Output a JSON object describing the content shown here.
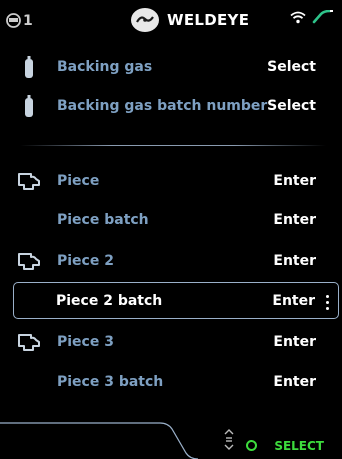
{
  "status": {
    "left_label": "1",
    "brand": "WELDEYE"
  },
  "rows": [
    {
      "label": "Backing gas",
      "action": "Select",
      "icon": "gas-bottle-icon"
    },
    {
      "label": "Backing gas batch number",
      "action": "Select",
      "icon": "gas-bottle-icon"
    },
    {
      "label": "Piece",
      "action": "Enter",
      "icon": "piece-icon"
    },
    {
      "label": "Piece batch",
      "action": "Enter",
      "icon": ""
    },
    {
      "label": "Piece 2",
      "action": "Enter",
      "icon": "piece-icon"
    },
    {
      "label": "Piece 2 batch",
      "action": "Enter",
      "icon": "",
      "selected": true
    },
    {
      "label": "Piece 3",
      "action": "Enter",
      "icon": "piece-icon"
    },
    {
      "label": "Piece 3 batch",
      "action": "Enter",
      "icon": ""
    }
  ],
  "bottom": {
    "select_label": "SELECT"
  },
  "colors": {
    "label": "#7ea0c2",
    "accent_green": "#3ddc3d",
    "selection_border": "#9ab0c9"
  }
}
